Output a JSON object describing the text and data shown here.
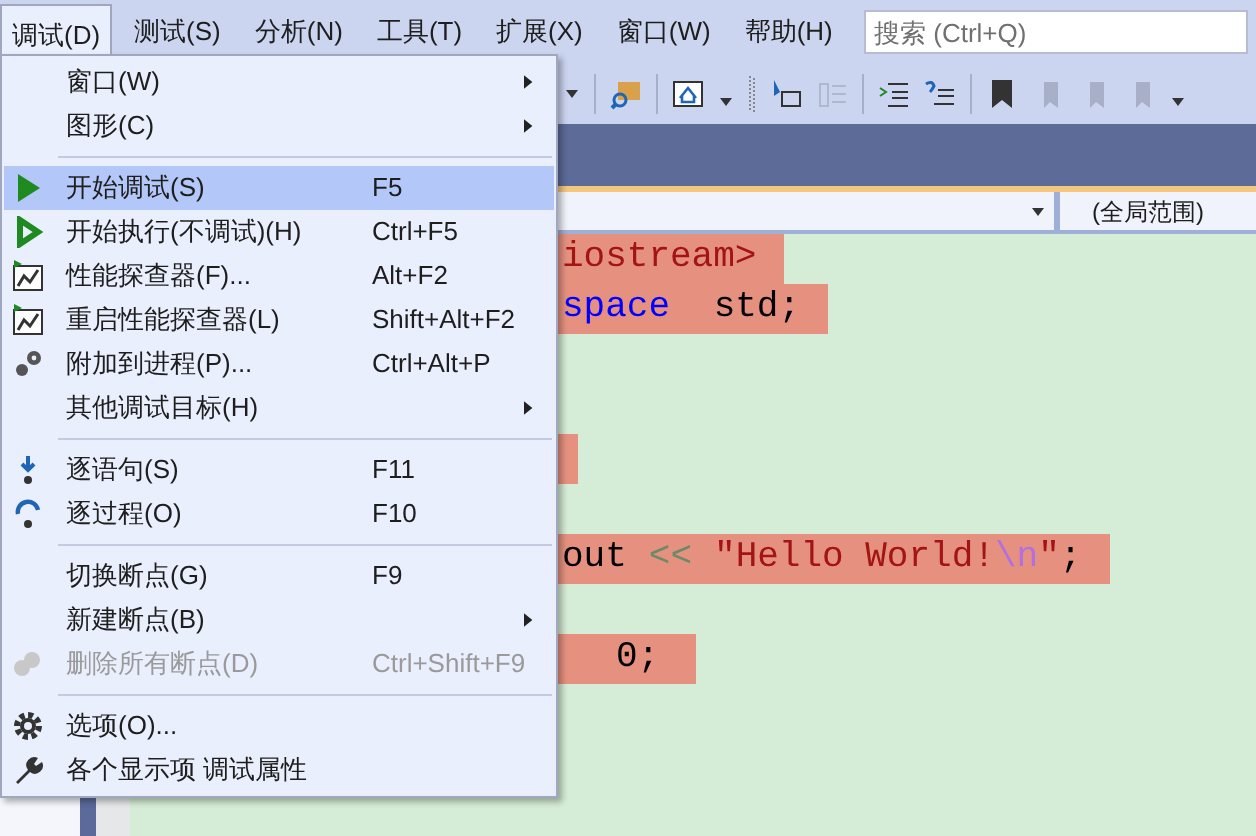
{
  "menubar": [
    {
      "label": "调试(D)",
      "selected": true
    },
    {
      "label": "测试(S)",
      "selected": false
    },
    {
      "label": "分析(N)",
      "selected": false
    },
    {
      "label": "工具(T)",
      "selected": false
    },
    {
      "label": "扩展(X)",
      "selected": false
    },
    {
      "label": "窗口(W)",
      "selected": false
    },
    {
      "label": "帮助(H)",
      "selected": false
    }
  ],
  "search": {
    "placeholder": "搜索 (Ctrl+Q)"
  },
  "scope_dropdown": {
    "value": "(全局范围)"
  },
  "code_lines": [
    {
      "kind": "code",
      "highlighted": true,
      "tokens": [
        {
          "kind": "string",
          "text": "iostream>"
        }
      ]
    },
    {
      "kind": "code",
      "highlighted": true,
      "tokens": [
        {
          "kind": "keyword",
          "text": "space"
        },
        {
          "kind": "plain",
          "text": " std;"
        }
      ]
    },
    {
      "kind": "blank"
    },
    {
      "kind": "blank"
    },
    {
      "kind": "code",
      "highlighted": true
    },
    {
      "kind": "blank"
    },
    {
      "kind": "code",
      "highlighted": true,
      "tokens": [
        {
          "kind": "plain",
          "text": "out"
        },
        {
          "kind": "operator",
          "text": "<<"
        },
        {
          "kind": "string",
          "text": "\"Hello World!"
        },
        {
          "kind": "escape",
          "text": "\\n"
        },
        {
          "kind": "string",
          "text": "\""
        },
        {
          "kind": "plain",
          "text": ";"
        }
      ]
    },
    {
      "kind": "blank"
    },
    {
      "kind": "code",
      "highlighted": true,
      "tokens": [
        {
          "kind": "plain",
          "text": "0;"
        }
      ]
    }
  ],
  "menu": [
    {
      "kind": "item",
      "label": "窗口(W)",
      "submenu": true,
      "disabled": false,
      "selected": false
    },
    {
      "kind": "item",
      "label": "图形(C)",
      "submenu": true,
      "disabled": false,
      "selected": false
    },
    {
      "kind": "separator"
    },
    {
      "kind": "item",
      "label": "开始调试(S)",
      "shortcut": "F5",
      "submenu": false,
      "disabled": false,
      "selected": true
    },
    {
      "kind": "item",
      "label": "开始执行(不调试)(H)",
      "shortcut": "Ctrl+F5",
      "submenu": false,
      "disabled": false,
      "selected": false
    },
    {
      "kind": "item",
      "label": "性能探查器(F)...",
      "shortcut": "Alt+F2",
      "submenu": false,
      "disabled": false,
      "selected": false
    },
    {
      "kind": "item",
      "label": "重启性能探查器(L)",
      "shortcut": "Shift+Alt+F2",
      "submenu": false,
      "disabled": false,
      "selected": false
    },
    {
      "kind": "item",
      "label": "附加到进程(P)...",
      "shortcut": "Ctrl+Alt+P",
      "submenu": false,
      "disabled": false,
      "selected": false
    },
    {
      "kind": "item",
      "label": "其他调试目标(H)",
      "submenu": true,
      "disabled": false,
      "selected": false
    },
    {
      "kind": "separator"
    },
    {
      "kind": "item",
      "label": "逐语句(S)",
      "shortcut": "F11",
      "submenu": false,
      "disabled": false,
      "selected": false
    },
    {
      "kind": "item",
      "label": "逐过程(O)",
      "shortcut": "F10",
      "submenu": false,
      "disabled": false,
      "selected": false
    },
    {
      "kind": "separator"
    },
    {
      "kind": "item",
      "label": "切换断点(G)",
      "shortcut": "F9",
      "submenu": false,
      "disabled": false,
      "selected": false
    },
    {
      "kind": "item",
      "label": "新建断点(B)",
      "submenu": true,
      "disabled": false,
      "selected": false
    },
    {
      "kind": "item",
      "label": "删除所有断点(D)",
      "shortcut": "Ctrl+Shift+F9",
      "submenu": false,
      "disabled": true,
      "selected": false
    },
    {
      "kind": "separator"
    },
    {
      "kind": "item",
      "label": "选项(O)...",
      "submenu": false,
      "disabled": false,
      "selected": false
    },
    {
      "kind": "item",
      "label": "各个显示项 调试属性",
      "submenu": false,
      "disabled": false,
      "selected": false
    }
  ]
}
